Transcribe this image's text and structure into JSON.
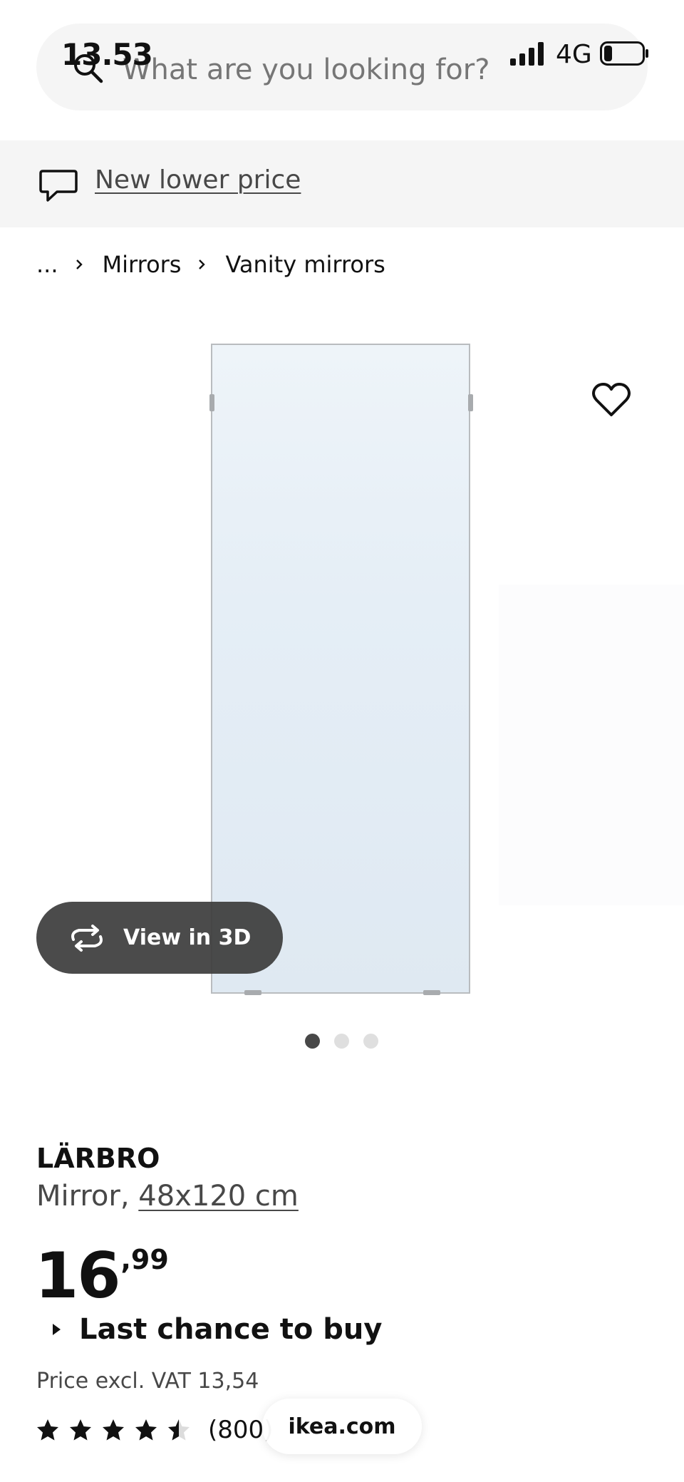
{
  "status_bar": {
    "time": "13.53",
    "network": "4G",
    "signal_icon": "signal-bars-icon",
    "battery_icon": "battery-icon"
  },
  "search": {
    "placeholder": "What are you looking for?",
    "icon": "search-icon"
  },
  "promo": {
    "label": "New lower price",
    "icon": "chat-bubble-icon"
  },
  "breadcrumb": {
    "items": [
      "...",
      "Mirrors",
      "Vanity mirrors"
    ],
    "separator_icon": "chevron-right-icon"
  },
  "gallery": {
    "view3d_label": "View in 3D",
    "view3d_icon": "rotate-3d-icon",
    "favorite_icon": "heart-icon",
    "slide_count": 3,
    "active_slide": 1
  },
  "product": {
    "name": "LÄRBRO",
    "type": "Mirror,",
    "size": "48x120 cm",
    "price_integer": "16",
    "price_decimal": ",99",
    "availability": "Last chance to buy",
    "vat_text": "Price excl. VAT 13,54",
    "rating": 4.5,
    "reviews": "(800)"
  },
  "browser_chip": {
    "label": "ikea.com"
  },
  "colors": {
    "accent_dark": "#111111",
    "muted_text": "#484848",
    "panel_bg": "#f5f5f5",
    "button_bg": "#3c3c3c"
  }
}
